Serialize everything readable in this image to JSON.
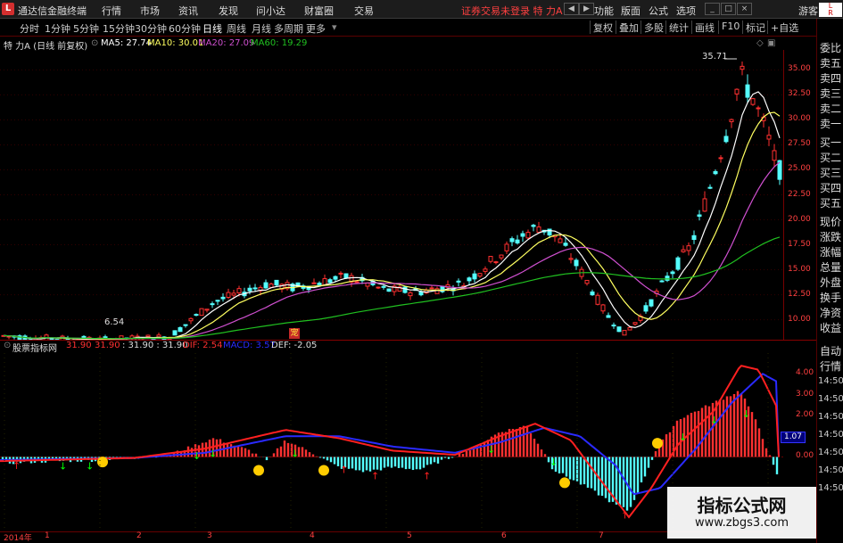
{
  "titlebar": {
    "app_title": "通达信金融终端",
    "menus": [
      "行情",
      "市场",
      "资讯",
      "发现",
      "问小达",
      "财富圈",
      "交易"
    ],
    "notice": "证券交易未登录  特 力A",
    "right_menus": [
      "功能",
      "版面",
      "公式",
      "选项"
    ],
    "guest": "游客"
  },
  "toolbar": {
    "periods": [
      "分时",
      "1分钟",
      "5分钟",
      "15分钟",
      "30分钟",
      "60分钟",
      "日线",
      "周线",
      "月线",
      "多周期",
      "更多"
    ],
    "active_period": "日线",
    "right_buttons": [
      "复权",
      "叠加",
      "多股",
      "统计",
      "画线",
      "F10",
      "标记",
      "+自选"
    ]
  },
  "info": {
    "stock": "特 力A (日线 前复权)",
    "ma5": "MA5: 27.74",
    "ma10": "MA10: 30.01",
    "ma20": "MA20: 27.09",
    "ma60": "MA60: 19.29"
  },
  "price_axis": [
    "35.00",
    "32.50",
    "30.00",
    "27.50",
    "25.00",
    "22.50",
    "20.00",
    "17.50",
    "15.00",
    "12.50",
    "10.00"
  ],
  "annotations": {
    "high": "35.71",
    "low": "6.54"
  },
  "indicator_bar": {
    "name": "股票指标网",
    "v1": "31.90",
    "v2": "31.90",
    "v3": ": 31.90 : 31.90",
    "dif": "DIF: 2.54",
    "macd": "MACD: 3.57",
    "def": "DEF: -2.05"
  },
  "macd_axis": [
    "4.00",
    "3.00",
    "2.00",
    "1.07",
    "0.00"
  ],
  "macd_badge": "1.07",
  "right_panel": [
    "委比",
    "卖五",
    "卖四",
    "卖三",
    "卖二",
    "卖一",
    "买一",
    "买二",
    "买三",
    "买四",
    "买五",
    "现价",
    "涨跌",
    "涨幅",
    "总量",
    "外盘",
    "换手",
    "净资",
    "收益"
  ],
  "right_panel_lower": [
    "自动",
    "行情",
    "14:50",
    "14:50",
    "14:50",
    "14:50",
    "14:50",
    "14:50",
    "14:50"
  ],
  "dates": [
    "2014年",
    "1",
    "2",
    "3",
    "4",
    "5",
    "6",
    "7"
  ],
  "watermark": {
    "line1": "指标公式网",
    "line2": "www.zbgs3.com"
  },
  "colors": {
    "up": "#ff3030",
    "down": "#54ffff",
    "ma5": "#ffffff",
    "ma10": "#ffff60",
    "ma20": "#d050d0",
    "ma60": "#20c020"
  },
  "chart_data": {
    "type": "line",
    "title": "特 力A (日线 前复权)",
    "xlabel": "",
    "ylabel": "",
    "x": [
      "2014年",
      "1",
      "2",
      "3",
      "4",
      "5",
      "6",
      "7"
    ],
    "ylim": [
      8,
      37
    ],
    "series": [
      {
        "name": "MA5",
        "values": [
          8.2,
          8.1,
          9.8,
          13.2,
          13.6,
          12.8,
          18.0,
          10.5,
          33.0
        ]
      },
      {
        "name": "MA10",
        "values": [
          8.3,
          8.2,
          9.3,
          12.8,
          13.5,
          12.9,
          17.0,
          11.5,
          30.0
        ]
      },
      {
        "name": "MA20",
        "values": [
          8.4,
          8.3,
          8.9,
          12.0,
          13.2,
          13.0,
          16.0,
          13.5,
          27.1
        ]
      },
      {
        "name": "MA60",
        "values": [
          8.6,
          8.4,
          8.5,
          10.0,
          11.5,
          12.8,
          14.2,
          14.5,
          19.3
        ]
      }
    ]
  }
}
